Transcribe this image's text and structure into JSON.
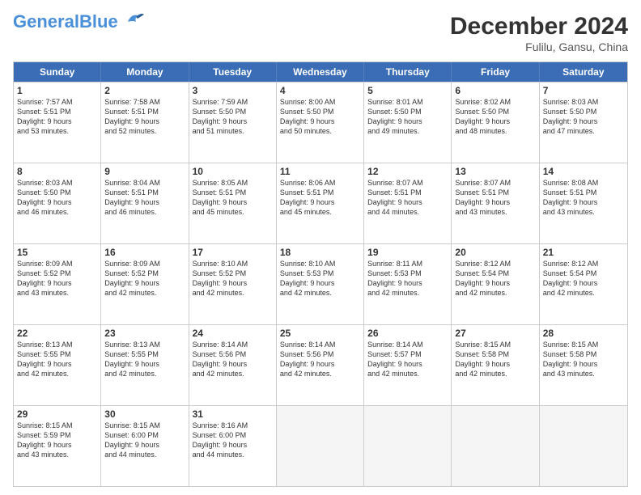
{
  "header": {
    "logo_general": "General",
    "logo_blue": "Blue",
    "month_year": "December 2024",
    "location": "Fulilu, Gansu, China"
  },
  "days_of_week": [
    "Sunday",
    "Monday",
    "Tuesday",
    "Wednesday",
    "Thursday",
    "Friday",
    "Saturday"
  ],
  "rows": [
    [
      {
        "day": "1",
        "lines": [
          "Sunrise: 7:57 AM",
          "Sunset: 5:51 PM",
          "Daylight: 9 hours",
          "and 53 minutes."
        ]
      },
      {
        "day": "2",
        "lines": [
          "Sunrise: 7:58 AM",
          "Sunset: 5:51 PM",
          "Daylight: 9 hours",
          "and 52 minutes."
        ]
      },
      {
        "day": "3",
        "lines": [
          "Sunrise: 7:59 AM",
          "Sunset: 5:50 PM",
          "Daylight: 9 hours",
          "and 51 minutes."
        ]
      },
      {
        "day": "4",
        "lines": [
          "Sunrise: 8:00 AM",
          "Sunset: 5:50 PM",
          "Daylight: 9 hours",
          "and 50 minutes."
        ]
      },
      {
        "day": "5",
        "lines": [
          "Sunrise: 8:01 AM",
          "Sunset: 5:50 PM",
          "Daylight: 9 hours",
          "and 49 minutes."
        ]
      },
      {
        "day": "6",
        "lines": [
          "Sunrise: 8:02 AM",
          "Sunset: 5:50 PM",
          "Daylight: 9 hours",
          "and 48 minutes."
        ]
      },
      {
        "day": "7",
        "lines": [
          "Sunrise: 8:03 AM",
          "Sunset: 5:50 PM",
          "Daylight: 9 hours",
          "and 47 minutes."
        ]
      }
    ],
    [
      {
        "day": "8",
        "lines": [
          "Sunrise: 8:03 AM",
          "Sunset: 5:50 PM",
          "Daylight: 9 hours",
          "and 46 minutes."
        ]
      },
      {
        "day": "9",
        "lines": [
          "Sunrise: 8:04 AM",
          "Sunset: 5:51 PM",
          "Daylight: 9 hours",
          "and 46 minutes."
        ]
      },
      {
        "day": "10",
        "lines": [
          "Sunrise: 8:05 AM",
          "Sunset: 5:51 PM",
          "Daylight: 9 hours",
          "and 45 minutes."
        ]
      },
      {
        "day": "11",
        "lines": [
          "Sunrise: 8:06 AM",
          "Sunset: 5:51 PM",
          "Daylight: 9 hours",
          "and 45 minutes."
        ]
      },
      {
        "day": "12",
        "lines": [
          "Sunrise: 8:07 AM",
          "Sunset: 5:51 PM",
          "Daylight: 9 hours",
          "and 44 minutes."
        ]
      },
      {
        "day": "13",
        "lines": [
          "Sunrise: 8:07 AM",
          "Sunset: 5:51 PM",
          "Daylight: 9 hours",
          "and 43 minutes."
        ]
      },
      {
        "day": "14",
        "lines": [
          "Sunrise: 8:08 AM",
          "Sunset: 5:51 PM",
          "Daylight: 9 hours",
          "and 43 minutes."
        ]
      }
    ],
    [
      {
        "day": "15",
        "lines": [
          "Sunrise: 8:09 AM",
          "Sunset: 5:52 PM",
          "Daylight: 9 hours",
          "and 43 minutes."
        ]
      },
      {
        "day": "16",
        "lines": [
          "Sunrise: 8:09 AM",
          "Sunset: 5:52 PM",
          "Daylight: 9 hours",
          "and 42 minutes."
        ]
      },
      {
        "day": "17",
        "lines": [
          "Sunrise: 8:10 AM",
          "Sunset: 5:52 PM",
          "Daylight: 9 hours",
          "and 42 minutes."
        ]
      },
      {
        "day": "18",
        "lines": [
          "Sunrise: 8:10 AM",
          "Sunset: 5:53 PM",
          "Daylight: 9 hours",
          "and 42 minutes."
        ]
      },
      {
        "day": "19",
        "lines": [
          "Sunrise: 8:11 AM",
          "Sunset: 5:53 PM",
          "Daylight: 9 hours",
          "and 42 minutes."
        ]
      },
      {
        "day": "20",
        "lines": [
          "Sunrise: 8:12 AM",
          "Sunset: 5:54 PM",
          "Daylight: 9 hours",
          "and 42 minutes."
        ]
      },
      {
        "day": "21",
        "lines": [
          "Sunrise: 8:12 AM",
          "Sunset: 5:54 PM",
          "Daylight: 9 hours",
          "and 42 minutes."
        ]
      }
    ],
    [
      {
        "day": "22",
        "lines": [
          "Sunrise: 8:13 AM",
          "Sunset: 5:55 PM",
          "Daylight: 9 hours",
          "and 42 minutes."
        ]
      },
      {
        "day": "23",
        "lines": [
          "Sunrise: 8:13 AM",
          "Sunset: 5:55 PM",
          "Daylight: 9 hours",
          "and 42 minutes."
        ]
      },
      {
        "day": "24",
        "lines": [
          "Sunrise: 8:14 AM",
          "Sunset: 5:56 PM",
          "Daylight: 9 hours",
          "and 42 minutes."
        ]
      },
      {
        "day": "25",
        "lines": [
          "Sunrise: 8:14 AM",
          "Sunset: 5:56 PM",
          "Daylight: 9 hours",
          "and 42 minutes."
        ]
      },
      {
        "day": "26",
        "lines": [
          "Sunrise: 8:14 AM",
          "Sunset: 5:57 PM",
          "Daylight: 9 hours",
          "and 42 minutes."
        ]
      },
      {
        "day": "27",
        "lines": [
          "Sunrise: 8:15 AM",
          "Sunset: 5:58 PM",
          "Daylight: 9 hours",
          "and 42 minutes."
        ]
      },
      {
        "day": "28",
        "lines": [
          "Sunrise: 8:15 AM",
          "Sunset: 5:58 PM",
          "Daylight: 9 hours",
          "and 43 minutes."
        ]
      }
    ],
    [
      {
        "day": "29",
        "lines": [
          "Sunrise: 8:15 AM",
          "Sunset: 5:59 PM",
          "Daylight: 9 hours",
          "and 43 minutes."
        ]
      },
      {
        "day": "30",
        "lines": [
          "Sunrise: 8:15 AM",
          "Sunset: 6:00 PM",
          "Daylight: 9 hours",
          "and 44 minutes."
        ]
      },
      {
        "day": "31",
        "lines": [
          "Sunrise: 8:16 AM",
          "Sunset: 6:00 PM",
          "Daylight: 9 hours",
          "and 44 minutes."
        ]
      },
      {
        "day": "",
        "lines": []
      },
      {
        "day": "",
        "lines": []
      },
      {
        "day": "",
        "lines": []
      },
      {
        "day": "",
        "lines": []
      }
    ]
  ]
}
